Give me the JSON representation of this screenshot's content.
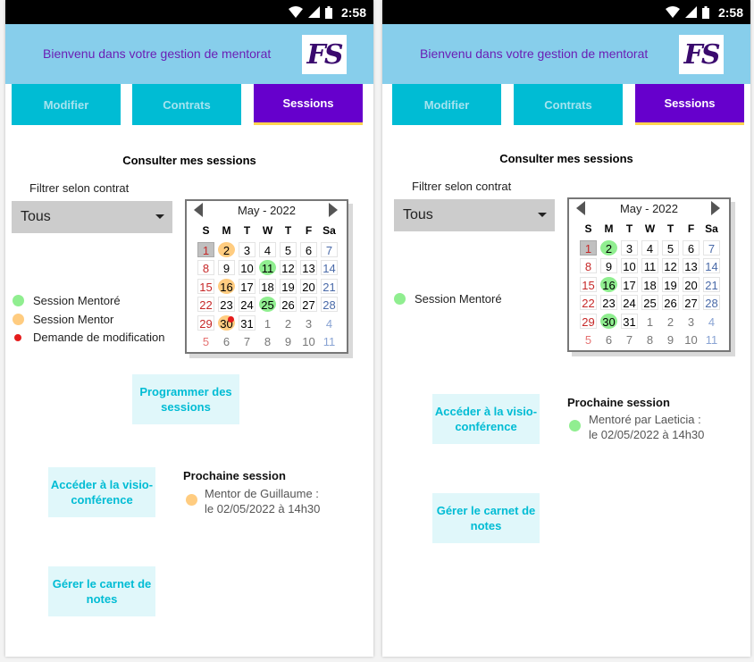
{
  "status": {
    "time": "2:58"
  },
  "header": {
    "title": "Bienvenu dans votre gestion de mentorat",
    "logo_text": "FS"
  },
  "tabs": [
    {
      "label": "Modifier"
    },
    {
      "label": "Contrats"
    },
    {
      "label": "Sessions"
    }
  ],
  "colors": {
    "accent": "#6600cc",
    "tab": "#00bcd4",
    "header": "#87ceeb",
    "mentore": "#90ee90",
    "mentor": "#ffcc80",
    "request": "#e51c1c"
  },
  "page_title": "Consulter mes sessions",
  "filter": {
    "label": "Filtrer selon contrat",
    "selected": "Tous"
  },
  "calendar": {
    "month_label": "May - 2022",
    "day_headers": [
      "S",
      "M",
      "T",
      "W",
      "T",
      "F",
      "Sa"
    ],
    "weeks": [
      [
        "1",
        "2",
        "3",
        "4",
        "5",
        "6",
        "7"
      ],
      [
        "8",
        "9",
        "10",
        "11",
        "12",
        "13",
        "14"
      ],
      [
        "15",
        "16",
        "17",
        "18",
        "19",
        "20",
        "21"
      ],
      [
        "22",
        "23",
        "24",
        "25",
        "26",
        "27",
        "28"
      ],
      [
        "29",
        "30",
        "31",
        "1",
        "2",
        "3",
        "4"
      ],
      [
        "5",
        "6",
        "7",
        "8",
        "9",
        "10",
        "11"
      ]
    ]
  },
  "screen_left": {
    "legend": [
      {
        "label": "Session Mentoré",
        "color": "#90ee90"
      },
      {
        "label": "Session Mentor",
        "color": "#ffcc80"
      },
      {
        "label": "Demande de modification",
        "color": "#e51c1c"
      }
    ],
    "marks": {
      "mentor": [
        "2",
        "16",
        "30"
      ],
      "mentore": [
        "11",
        "25"
      ],
      "request": [
        "30"
      ]
    },
    "buttons": {
      "program": "Programmer des sessions",
      "visio": "Accéder à la visio-conférence",
      "notes": "Gérer le carnet de notes"
    },
    "next_session": {
      "title": "Prochaine session",
      "line1": "Mentor de Guillaume :",
      "line2": "le 02/05/2022 à 14h30"
    }
  },
  "screen_right": {
    "legend": [
      {
        "label": "Session Mentoré",
        "color": "#90ee90"
      }
    ],
    "marks": {
      "mentor": [],
      "mentore": [
        "2",
        "16",
        "30"
      ],
      "request": []
    },
    "buttons": {
      "visio": "Accéder à la visio-conférence",
      "notes": "Gérer le carnet de notes"
    },
    "next_session": {
      "title": "Prochaine session",
      "line1": "Mentoré par Laeticia :",
      "line2": "le 02/05/2022 à 14h30"
    }
  }
}
